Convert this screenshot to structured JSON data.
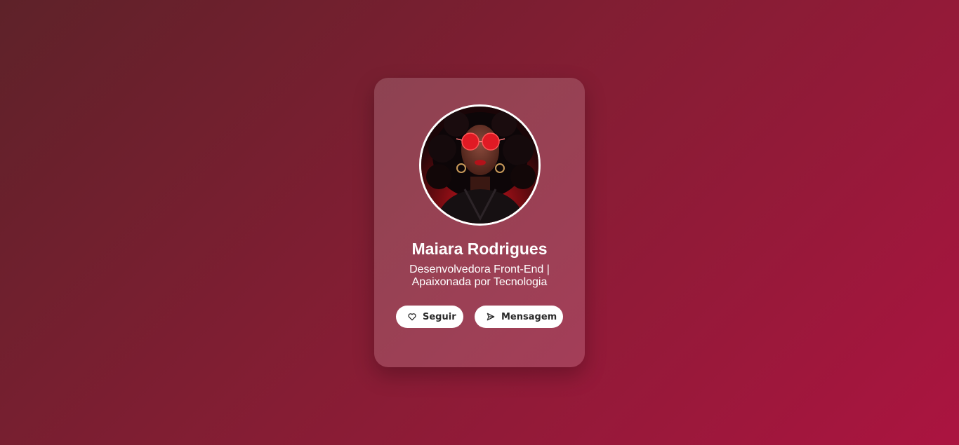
{
  "profile": {
    "name": "Maiara Rodrigues",
    "bio": "Desenvolvedora Front-End | Apaixonada por Tecnologia",
    "avatar_icon": "profile-photo"
  },
  "actions": {
    "follow_label": "Seguir",
    "follow_icon": "heart-icon",
    "message_label": "Mensagem",
    "message_icon": "send-icon"
  },
  "colors": {
    "background_start": "#5e2229",
    "background_end": "#ab1440",
    "card": "rgba(255,255,255,0.16)",
    "button": "#ffffff",
    "text": "#ffffff"
  }
}
